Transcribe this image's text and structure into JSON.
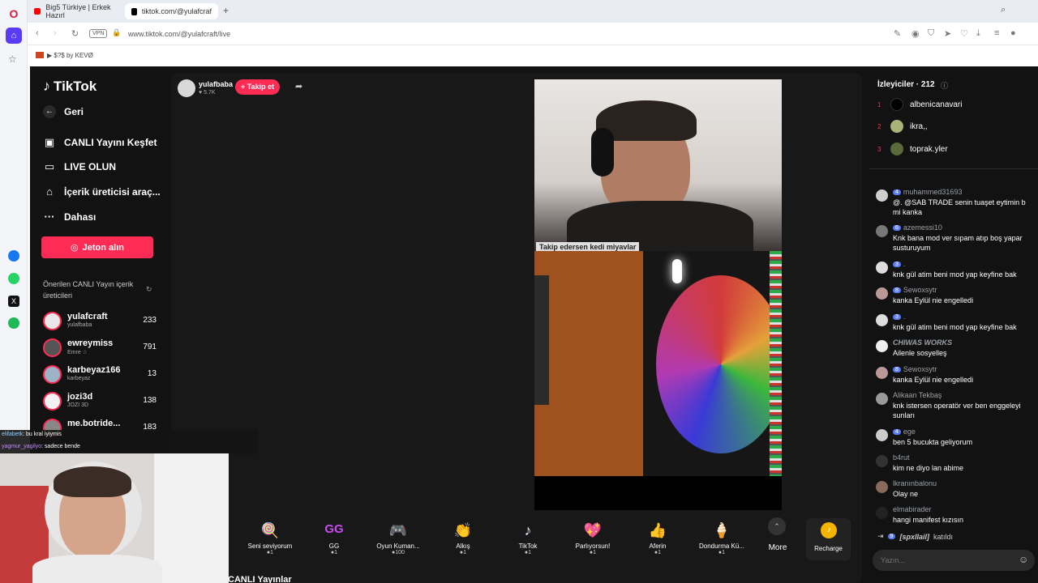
{
  "browser": {
    "tabs": [
      {
        "label": "Big5 Türkiye | Erkek Hazırl"
      },
      {
        "label": "tiktok.com/@yulafcraf"
      }
    ],
    "new_tab": "+",
    "vpn": "VPN",
    "url": "www.tiktok.com/@yulafcraft/live",
    "bookmark": "▶ $?$ by KEVØ"
  },
  "sidebar": {
    "logo": "TikTok",
    "back": "Geri",
    "items": [
      {
        "label": "CANLI Yayını Keşfet"
      },
      {
        "label": "LIVE OLUN"
      },
      {
        "label": "İçerik üreticisi araç..."
      },
      {
        "label": "Dahası"
      }
    ],
    "jeton": "Jeton alın",
    "suggest_title": "Önerilen CANLI Yayın içerik üreticileri",
    "creators": [
      {
        "name": "yulafcraft",
        "sub": "yulafbaba",
        "count": "233"
      },
      {
        "name": "ewreymiss",
        "sub": "Emre ☆",
        "count": "791"
      },
      {
        "name": "karbeyaz166",
        "sub": "karbeyaz",
        "count": "13"
      },
      {
        "name": "jozi3d",
        "sub": "JOZI 3D",
        "count": "138"
      },
      {
        "name": "me.botride...",
        "sub": "",
        "count": "183"
      }
    ]
  },
  "host": {
    "name": "yulafbaba",
    "likes": "♥ 5.7K",
    "follow": "+ Takip et"
  },
  "video": {
    "caption": "Takip edersen kedi miyavlar"
  },
  "gifts": [
    {
      "name": "Seni seviyorum",
      "price": "1",
      "icon": "🍭"
    },
    {
      "name": "GG",
      "price": "1",
      "icon": "GG"
    },
    {
      "name": "Oyun Kuman...",
      "price": "100",
      "icon": "🎮"
    },
    {
      "name": "Alkış",
      "price": "1",
      "icon": "👏"
    },
    {
      "name": "TikTok",
      "price": "1",
      "icon": "♪"
    },
    {
      "name": "Parlıyorsun!",
      "price": "1",
      "icon": "💖"
    },
    {
      "name": "Aferin",
      "price": "1",
      "icon": "👍"
    },
    {
      "name": "Dondurma Kü...",
      "price": "1",
      "icon": "🍦"
    }
  ],
  "more": "More",
  "recharge": "Recharge",
  "bottom_section": "CANLI Yayınlar",
  "chat": {
    "viewers_title": "İzleyiciler · 212",
    "viewers": [
      {
        "rank": "1",
        "name": "albenicanavari"
      },
      {
        "rank": "2",
        "name": "ikra,,"
      },
      {
        "rank": "3",
        "name": "toprak.yler"
      }
    ],
    "messages": [
      {
        "level": "4",
        "user": "muhammed31693",
        "text": "@. @SAB TRADE senin tuaşet eytimin b",
        "text2": "mi kanka"
      },
      {
        "level": "6",
        "user": "azemessi10",
        "text": "Knk bana mod ver sıpam atıp boş yapar",
        "text2": "susturuyum"
      },
      {
        "level": "3",
        "user": ".",
        "text": "knk gül atim beni mod yap keyfine bak",
        "text2": ""
      },
      {
        "level": "8",
        "user": "Sewoxsytr",
        "text": "kanka Eylül nie engelledi",
        "text2": ""
      },
      {
        "level": "3",
        "user": ".",
        "text": "knk gül atim beni mod yap keyfine bak",
        "text2": ""
      },
      {
        "level": "",
        "user": "CHIWAS WORKS",
        "text": "Ailenle sosyelleş",
        "text2": ""
      },
      {
        "level": "8",
        "user": "Sewoxsytr",
        "text": "kanka Eylül nie engelledi",
        "text2": ""
      },
      {
        "level": "",
        "user": "Alikaan Tekbaş",
        "text": "knk istersen operatör ver ben enggeleyi",
        "text2": "sunları"
      },
      {
        "level": "4",
        "user": "ege",
        "text": "ben 5 bucukta geliyorum",
        "text2": ""
      },
      {
        "level": "",
        "user": "b4rut",
        "text": "kim ne diyo lan abime",
        "text2": ""
      },
      {
        "level": "",
        "user": "lkranınbalonu",
        "text": "Olay ne",
        "text2": ""
      },
      {
        "level": "",
        "user": "elmabirader",
        "text": "hangi manifest kızısın",
        "text2": ""
      }
    ],
    "join_level": "9",
    "join_user": "[spxllail]",
    "join_text": "katıldı",
    "input_placeholder": "Yazın..."
  },
  "overlay_chat": [
    {
      "user": "elifabetk",
      "text": ": bu kral iyiymis"
    },
    {
      "user": "yagmur_yagilyo",
      "text": ": sadece bende"
    }
  ]
}
